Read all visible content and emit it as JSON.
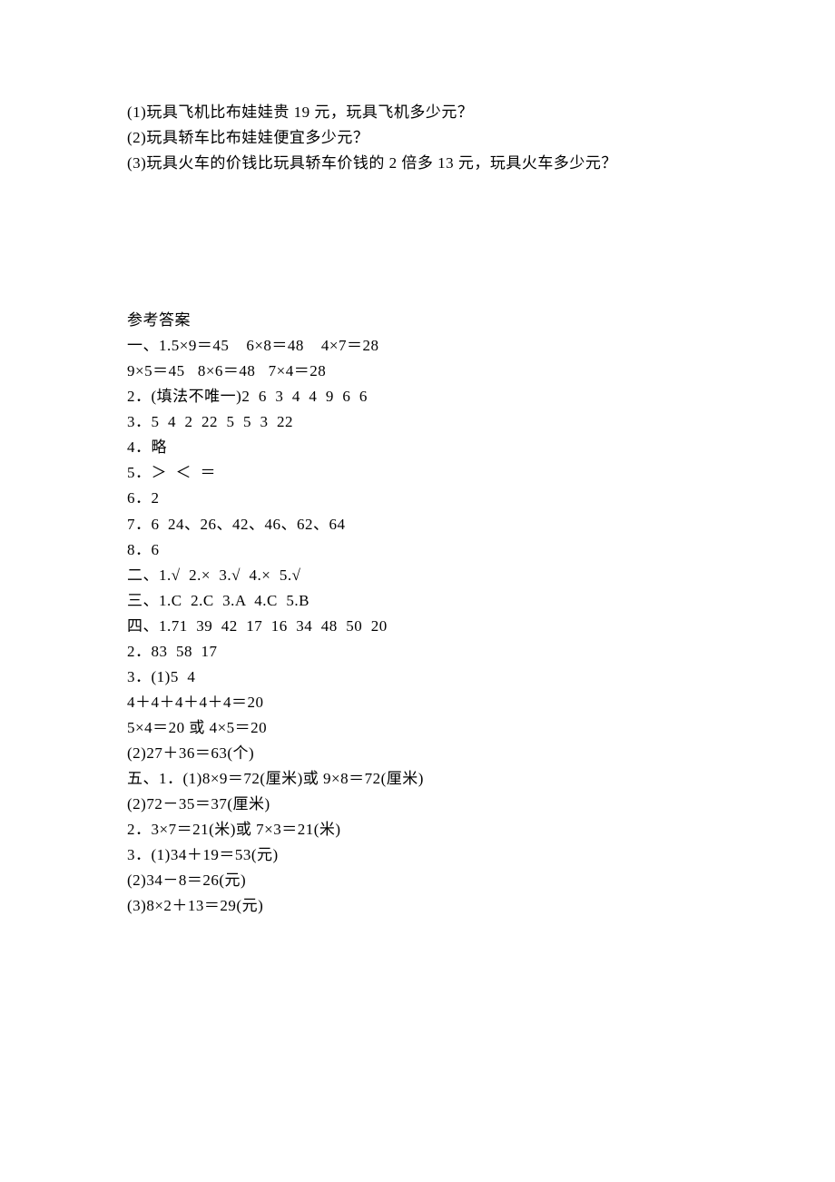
{
  "questions": {
    "q1": "(1)玩具飞机比布娃娃贵 19 元，玩具飞机多少元？",
    "q2": "(2)玩具轿车比布娃娃便宜多少元？",
    "q3": "(3)玩具火车的价钱比玩具轿车价钱的 2 倍多 13 元，玩具火车多少元？"
  },
  "answers": {
    "title": "参考答案",
    "a1_1": "一、1.5×9＝45    6×8＝48    4×7＝28",
    "a1_2": "9×5＝45   8×6＝48   7×4＝28",
    "a2": "2．(填法不唯一)2  6  3  4  4  9  6  6",
    "a3": "3．5  4  2  22  5  5  3  22",
    "a4": "4．略",
    "a5": "5．＞  ＜  ＝",
    "a6": "6．2",
    "a7": "7．6  24、26、42、46、62、64",
    "a8": "8．6",
    "a_er": "二、1.√  2.×  3.√  4.×  5.√",
    "a_san": "三、1.C  2.C  3.A  4.C  5.B",
    "a_si_1": "四、1.71  39  42  17  16  34  48  50  20",
    "a_si_2": "2．83  58  17",
    "a_si_3": "3．(1)5  4",
    "a_si_3b": "4＋4＋4＋4＋4＝20",
    "a_si_3c": "5×4＝20 或 4×5＝20",
    "a_si_3d": "(2)27＋36＝63(个)",
    "a_wu_1": "五、1．(1)8×9＝72(厘米)或 9×8＝72(厘米)",
    "a_wu_2": "(2)72－35＝37(厘米)",
    "a_wu_3": "2．3×7＝21(米)或 7×3＝21(米)",
    "a_wu_4": "3．(1)34＋19＝53(元)",
    "a_wu_5": "(2)34－8＝26(元)",
    "a_wu_6": "(3)8×2＋13＝29(元)"
  }
}
